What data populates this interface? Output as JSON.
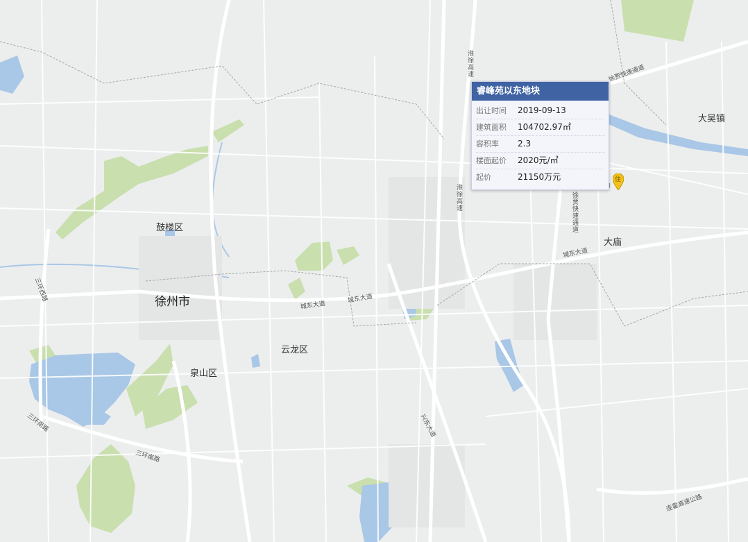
{
  "places": {
    "xuzhou": "徐州市",
    "gulou": "鼓楼区",
    "yunlong": "云龙区",
    "quanshan": "泉山区",
    "dawu": "大吴镇",
    "damiao": "大庙"
  },
  "roads": {
    "huaixu_top": "淮徐高速",
    "huaixu_mid": "淮徐高速",
    "xujia_kuaisu": "徐贾快速通道",
    "xujia_vertical": "徐贾快速通道",
    "chengdong_1": "城东大道",
    "chengdong_2": "城东大道",
    "chengdong_3": "城东大道",
    "sanhuan_xi": "三环西路",
    "sanhuan_nan_1": "三环南路",
    "sanhuan_nan_2": "三环南路",
    "xingdong": "兴东大道",
    "lianhuo": "连霍高速公路"
  },
  "popup": {
    "title": "睿峰苑以东地块",
    "rows": [
      {
        "key": "出让时间",
        "value": "2019-09-13"
      },
      {
        "key": "建筑面积",
        "value": "104702.97㎡"
      },
      {
        "key": "容积率",
        "value": "2.3"
      },
      {
        "key": "楼面起价",
        "value": "2020元/㎡"
      },
      {
        "key": "起价",
        "value": "21150万元"
      }
    ]
  },
  "marker": {
    "label": "住"
  },
  "colors": {
    "water": "#a9c7e6",
    "green": "#c9dfae",
    "road": "#ffffff",
    "popup_header": "#3f63a3"
  }
}
